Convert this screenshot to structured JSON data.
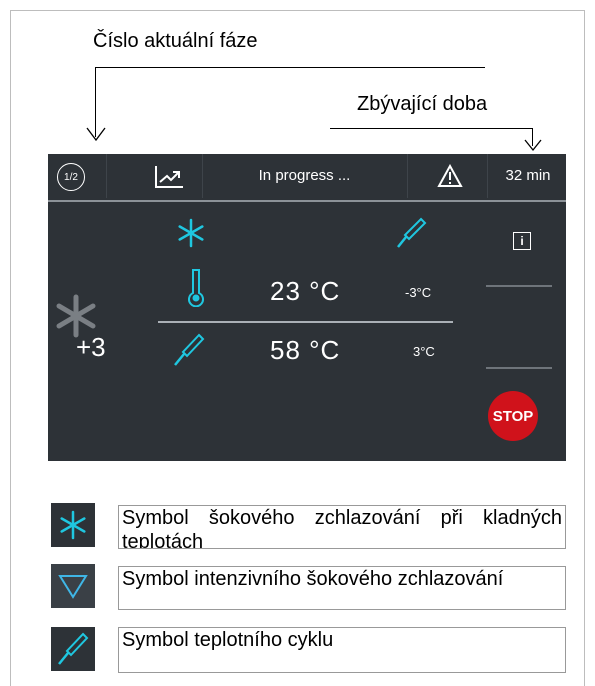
{
  "callouts": {
    "phase_number": "Číslo aktuální fáze",
    "remaining_time": "Zbývající doba"
  },
  "panel": {
    "phase": "1/2",
    "status": "In progress ...",
    "time": "32 min",
    "temp_probe": "23 °C",
    "temp_probe_offset": "-3°C",
    "temp_core": "58 °C",
    "temp_core_offset": "3°C",
    "mode_value": "+3",
    "stop_label": "STOP",
    "info_label": "i"
  },
  "legend": [
    {
      "icon": "snowflake-icon",
      "text": "Symbol šokového zchlazování při kladných teplotách"
    },
    {
      "icon": "triangle-down-icon",
      "text": "Symbol intenzivního šokového zchlazování"
    },
    {
      "icon": "probe-icon",
      "text": "Symbol teplotního cyklu"
    }
  ],
  "colors": {
    "panel_bg": "#2d3237",
    "accent": "#1fc7e0",
    "stop": "#d0121b"
  }
}
